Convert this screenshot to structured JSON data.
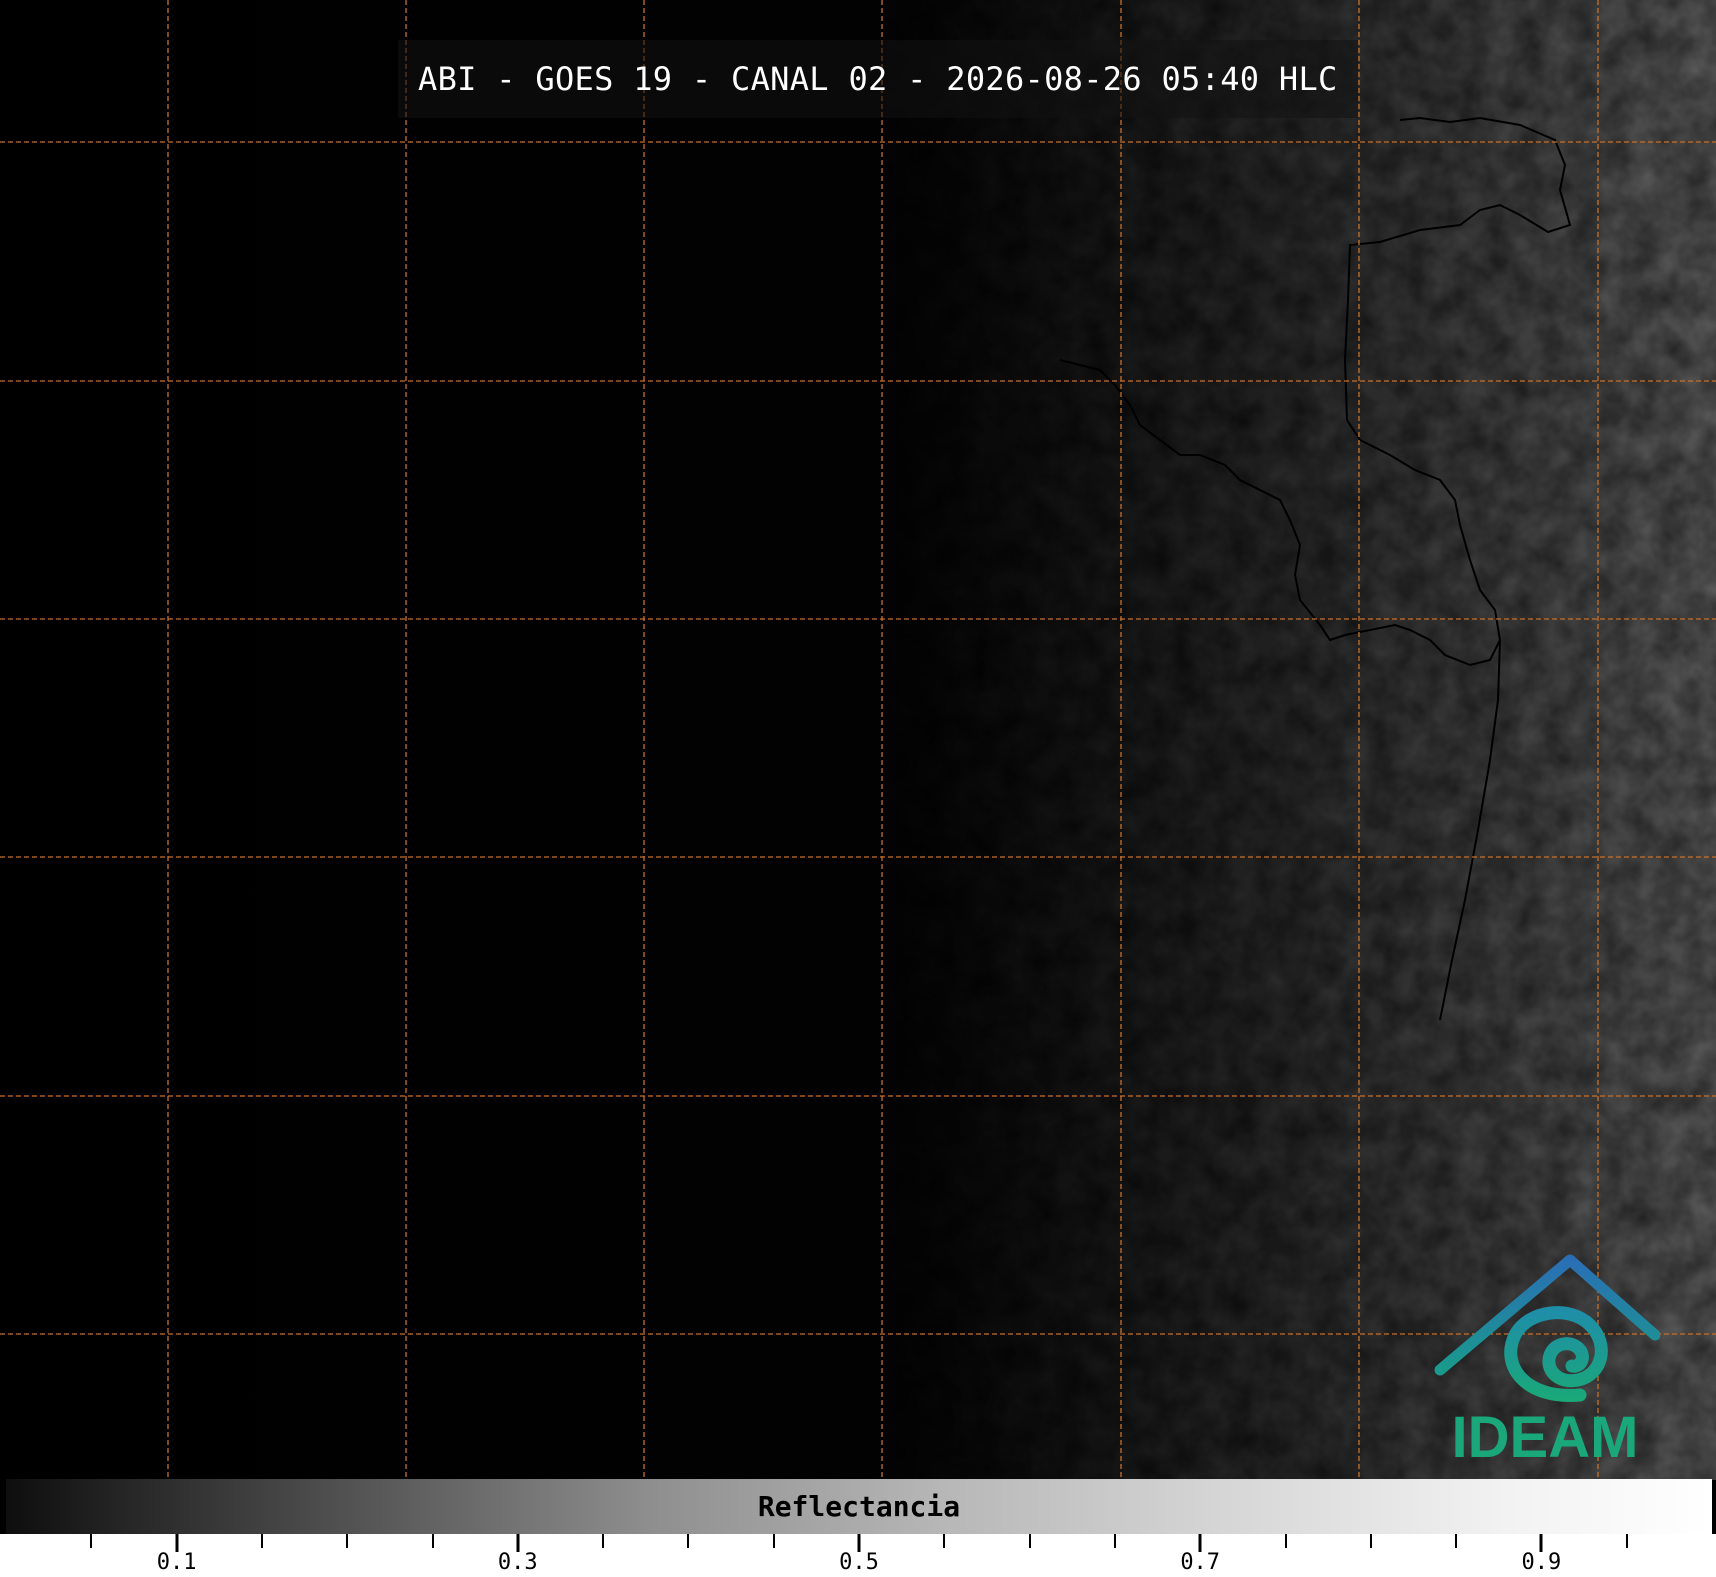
{
  "title": "ABI - GOES 19 - CANAL 02 - 2026-08-26 05:40 HLC",
  "colorbar": {
    "label": "Reflectancia",
    "min": 0.0,
    "max": 1.0,
    "major_ticks": [
      0.1,
      0.3,
      0.5,
      0.7,
      0.9
    ],
    "major_tick_labels": [
      "0.1",
      "0.3",
      "0.5",
      "0.7",
      "0.9"
    ],
    "minor_ticks": [
      0.05,
      0.15,
      0.2,
      0.25,
      0.35,
      0.4,
      0.45,
      0.55,
      0.6,
      0.65,
      0.75,
      0.8,
      0.85,
      0.95
    ]
  },
  "logo": {
    "text": "IDEAM",
    "color_blue": "#2a6fb5",
    "color_green": "#1aa77a"
  },
  "colors": {
    "background": "#000000",
    "gridline": "#c8702a",
    "title_text": "#ffffff"
  }
}
